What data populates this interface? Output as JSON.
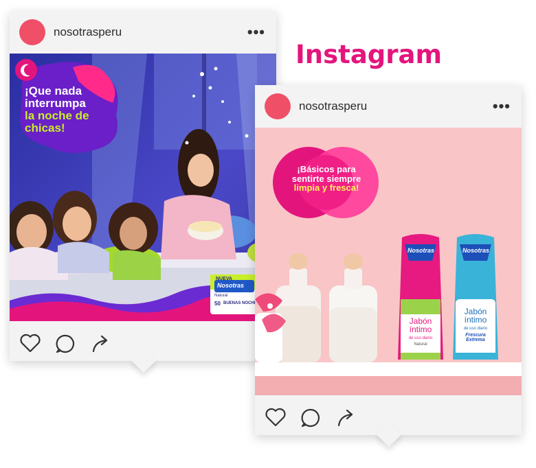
{
  "headline": "Instagram",
  "post1": {
    "username": "nosotrasperu",
    "more": "•••",
    "promo_line1": "¡Que nada",
    "promo_line2": "interrumpa",
    "promo_line3": "la noche de",
    "promo_line4": "chicas!",
    "pack_brand": "Nosotras",
    "pack_variant": "Natural",
    "pack_count": "50",
    "pack_name": "BUENAS NOCHES",
    "pack_flag": "NUEVA"
  },
  "post2": {
    "username": "nosotrasperu",
    "more": "•••",
    "promo_line1": "¡Básicos para",
    "promo_line2": "sentirte siempre",
    "promo_line3": "limpia y fresca!",
    "bottle1_brand": "Nosotras",
    "bottle1_name": "Jabón íntimo",
    "bottle1_sub": "de uso diario",
    "bottle1_variant": "Natural",
    "bottle2_brand": "Nosotras",
    "bottle2_name": "Jabón íntimo",
    "bottle2_sub": "de uso diario",
    "bottle2_variant": "Frescura Extrema"
  },
  "colors": {
    "accent": "#e3157d",
    "avatar": "#ef5068",
    "lime": "#c8ef2a"
  },
  "icons": [
    "heart-icon",
    "comment-icon",
    "share-icon",
    "more-icon"
  ]
}
